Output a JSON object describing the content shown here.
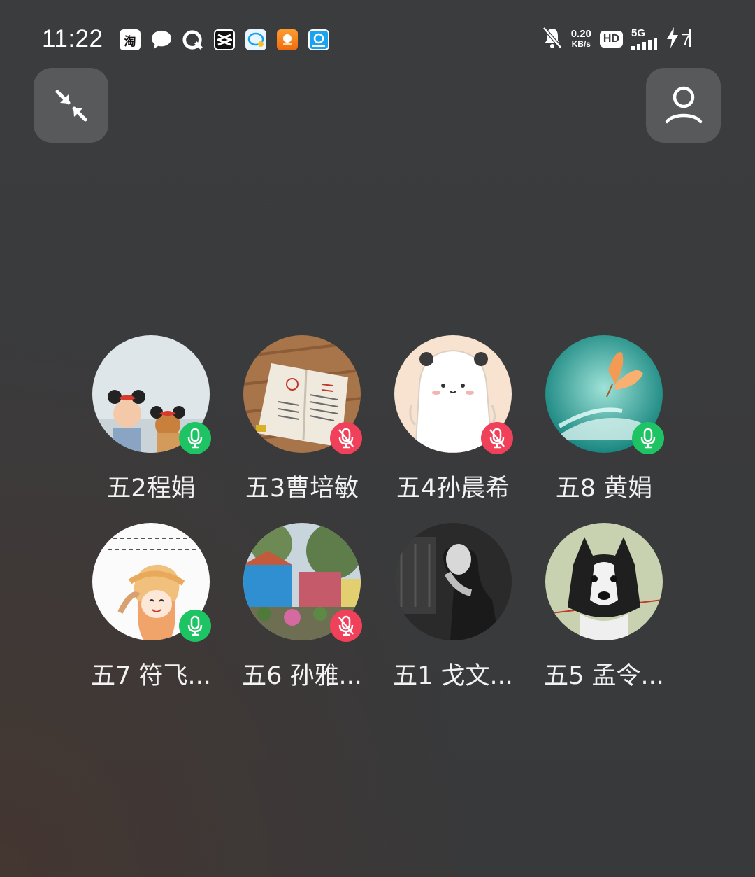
{
  "status_bar": {
    "time": "11:22",
    "notification_icons": [
      "taobao-icon",
      "chat-bubble-icon",
      "q-app-icon",
      "capcut-icon",
      "message-app-icon",
      "orange-app-icon",
      "blue-app-icon"
    ],
    "taobao_glyph": "淘",
    "net_speed_value": "0.20",
    "net_speed_unit": "KB/s",
    "hd_label": "HD",
    "network_label": "5G",
    "battery_level": "7"
  },
  "controls": {
    "collapse_icon": "collapse-arrows-icon",
    "contacts_icon": "person-icon"
  },
  "members": [
    {
      "name": "五2程娟",
      "mic": "on"
    },
    {
      "name": "五3曹培敏",
      "mic": "off"
    },
    {
      "name": "五4孙晨希",
      "mic": "off"
    },
    {
      "name": "五8  黄娟",
      "mic": "on"
    },
    {
      "name": "五7 符飞...",
      "mic": "on"
    },
    {
      "name": "五6 孙雅...",
      "mic": "off"
    },
    {
      "name": "五1 戈文...",
      "mic": "none"
    },
    {
      "name": "五5 孟令...",
      "mic": "none"
    }
  ],
  "colors": {
    "background": "#3a3b3d",
    "button_bg": "#58595b",
    "mic_on": "#1ec463",
    "mic_off": "#f0405a"
  }
}
